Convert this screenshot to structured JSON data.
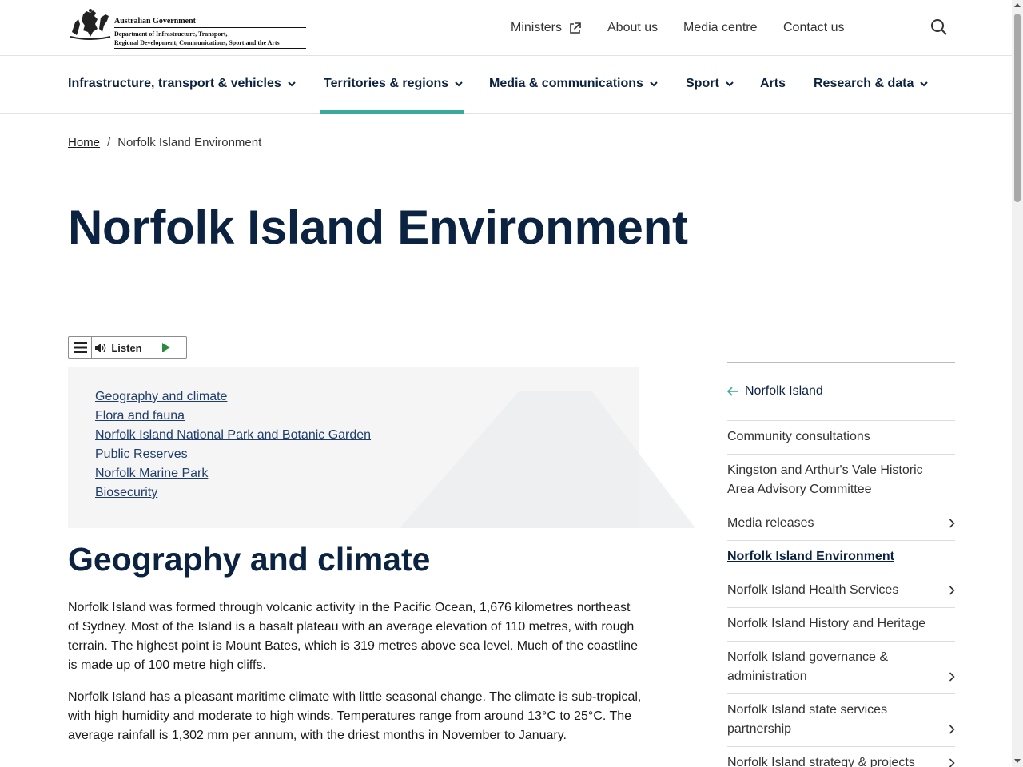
{
  "header": {
    "logo": {
      "gov_name": "Australian Government",
      "dept_line1": "Department of Infrastructure, Transport,",
      "dept_line2": "Regional Development, Communications, Sport and the Arts"
    },
    "utility_links": [
      {
        "label": "Ministers",
        "external": true
      },
      {
        "label": "About us"
      },
      {
        "label": "Media centre"
      },
      {
        "label": "Contact us"
      }
    ]
  },
  "main_nav": [
    {
      "label": "Infrastructure, transport & vehicles",
      "has_dropdown": true
    },
    {
      "label": "Territories & regions",
      "has_dropdown": true,
      "active": true
    },
    {
      "label": "Media & communications",
      "has_dropdown": true
    },
    {
      "label": "Sport",
      "has_dropdown": true
    },
    {
      "label": "Arts",
      "has_dropdown": false
    },
    {
      "label": "Research & data",
      "has_dropdown": true
    }
  ],
  "breadcrumb": {
    "home": "Home",
    "separator": "/",
    "current": "Norfolk Island Environment"
  },
  "page_title": "Norfolk Island Environment",
  "listen": {
    "label": "Listen"
  },
  "toc": [
    "Geography and climate",
    "Flora and fauna",
    "Norfolk Island National Park and Botanic Garden",
    "Public Reserves",
    "Norfolk Marine Park",
    "Biosecurity"
  ],
  "section": {
    "heading": "Geography and climate",
    "paragraphs": [
      "Norfolk Island was formed through volcanic activity in the Pacific Ocean, 1,676 kilometres northeast of Sydney. Most of the Island is a basalt plateau with an average elevation of 110 metres, with rough terrain. The highest point is Mount Bates, which is 319 metres above sea level. Much of the coastline is made up of 100 metre high cliffs.",
      "Norfolk Island has a pleasant maritime climate with little seasonal change. The climate is sub-tropical, with high humidity and moderate to high winds. Temperatures range from around 13°C to 25°C. The average rainfall is 1,302 mm per annum, with the driest months in November to January."
    ]
  },
  "sidebar": {
    "back_label": "Norfolk Island",
    "items": [
      {
        "label": "Community consultations",
        "has_children": false
      },
      {
        "label": "Kingston and Arthur's Vale Historic Area Advisory Committee",
        "has_children": false
      },
      {
        "label": "Media releases",
        "has_children": true
      },
      {
        "label": "Norfolk Island Environment",
        "has_children": false,
        "active": true
      },
      {
        "label": "Norfolk Island Health Services",
        "has_children": true
      },
      {
        "label": "Norfolk Island History and Heritage",
        "has_children": false
      },
      {
        "label": "Norfolk Island governance & administration",
        "has_children": true
      },
      {
        "label": "Norfolk Island state services partnership",
        "has_children": true
      },
      {
        "label": "Norfolk Island strategy & projects",
        "has_children": true
      }
    ]
  },
  "colors": {
    "navy": "#0b2341",
    "accent_teal": "#3ba99c",
    "toc_bg": "#f5f5f5",
    "link": "#1f3d6b"
  }
}
